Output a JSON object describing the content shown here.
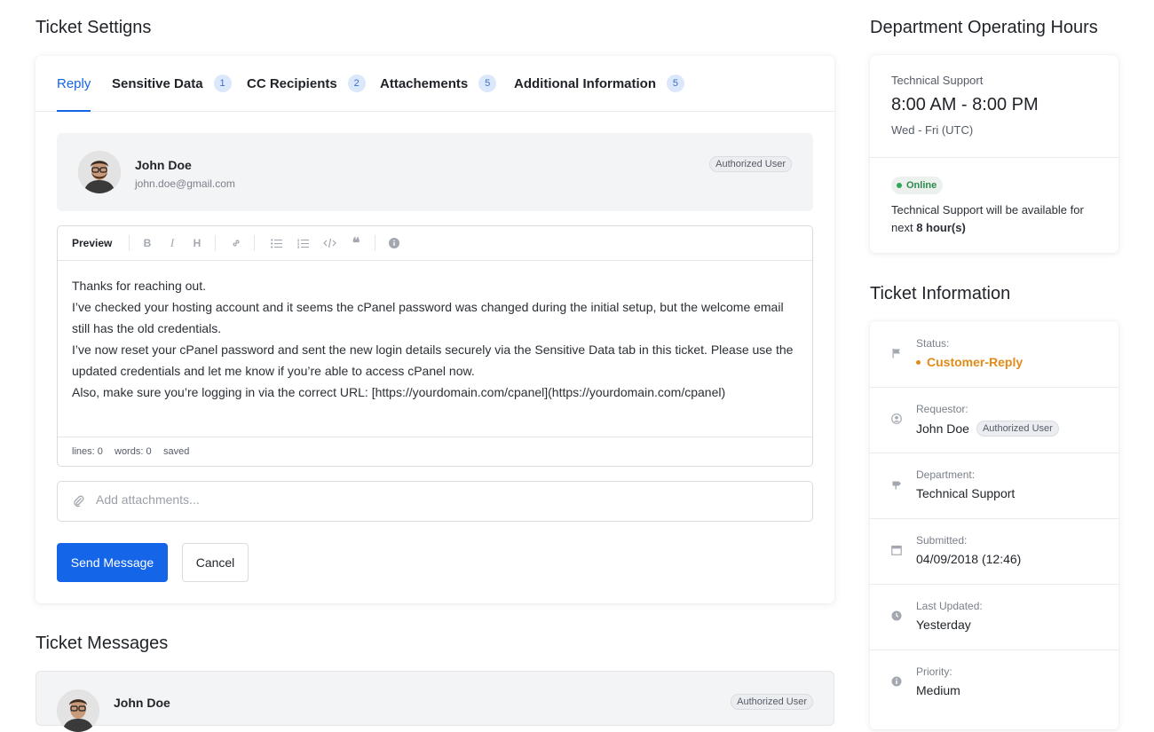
{
  "titles": {
    "ticket_settings": "Ticket Settigns",
    "ticket_messages": "Ticket Messages",
    "department_hours": "Department Operating Hours",
    "ticket_information": "Ticket Information"
  },
  "tabs": [
    {
      "label": "Reply",
      "count": null,
      "active": true
    },
    {
      "label": "Sensitive Data",
      "count": "1",
      "active": false
    },
    {
      "label": "CC Recipients",
      "count": "2",
      "active": false
    },
    {
      "label": "Attachements",
      "count": "5",
      "active": false
    },
    {
      "label": "Additional Information",
      "count": "5",
      "active": false
    }
  ],
  "reply_user": {
    "name": "John Doe",
    "email": "john.doe@gmail.com",
    "role": "Authorized User"
  },
  "editor": {
    "preview_label": "Preview",
    "toolbar_icons": [
      "bold-icon",
      "italic-icon",
      "heading-icon",
      "link-icon",
      "bullet-list-icon",
      "numbered-list-icon",
      "code-icon",
      "quote-icon",
      "info-icon"
    ],
    "lines": [
      "Thanks for reaching out.",
      "I’ve checked your hosting account and it seems the cPanel password was changed during the initial setup, but the welcome email still has the old credentials.",
      "I’ve now reset your cPanel password and sent the new login details securely via the Sensitive Data tab in this ticket. Please use the updated credentials and let me know if you’re able to access cPanel now.",
      "Also, make sure you’re logging in via the correct URL: [https://yourdomain.com/cpanel](https://yourdomain.com/cpanel)"
    ],
    "status": {
      "lines": "lines: 0",
      "words": "words: 0",
      "saved": "saved"
    }
  },
  "attachments": {
    "placeholder": "Add attachments..."
  },
  "actions": {
    "send": "Send Message",
    "cancel": "Cancel"
  },
  "messages": [
    {
      "name": "John Doe",
      "role": "Authorized User"
    }
  ],
  "hours": {
    "department": "Technical Support",
    "time": "8:00 AM - 8:00 PM",
    "days": "Wed - Fri (UTC)",
    "online_label": "Online",
    "availability_prefix": "Technical Support will be available for next",
    "availability_hours": "8 hour(s)"
  },
  "info": {
    "status_label": "Status:",
    "status_value": "Customer-Reply",
    "requestor_label": "Requestor:",
    "requestor_value": "John Doe",
    "requestor_role": "Authorized User",
    "department_label": "Department:",
    "department_value": "Technical Support",
    "submitted_label": "Submitted:",
    "submitted_value": "04/09/2018 (12:46)",
    "updated_label": "Last Updated:",
    "updated_value": "Yesterday",
    "priority_label": "Priority:",
    "priority_value": "Medium"
  },
  "colors": {
    "accent": "#1565e8",
    "status_customer_reply": "#e38a1a",
    "online": "#2fa85a"
  }
}
